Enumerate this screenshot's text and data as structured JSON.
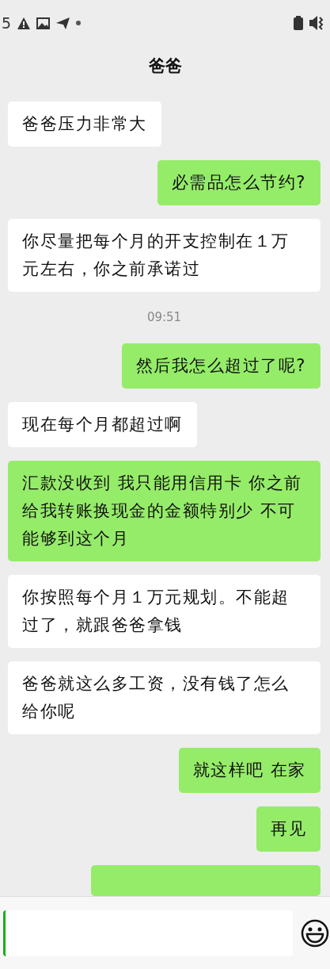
{
  "status_bar": {
    "time": "5"
  },
  "header": {
    "title": "爸爸"
  },
  "messages": [
    {
      "kind": "message",
      "sent": false,
      "text": "爸爸压力非常大"
    },
    {
      "kind": "message",
      "sent": true,
      "text": "必需品怎么节约?"
    },
    {
      "kind": "message",
      "sent": false,
      "text": "你尽量把每个月的开支控制在１万元左右，你之前承诺过"
    },
    {
      "kind": "time",
      "text": "09:51"
    },
    {
      "kind": "message",
      "sent": true,
      "text": "然后我怎么超过了呢?"
    },
    {
      "kind": "message",
      "sent": false,
      "text": "现在每个月都超过啊"
    },
    {
      "kind": "message",
      "sent": true,
      "text": "汇款没收到 我只能用信用卡 你之前给我转账换现金的金额特别少 不可能够到这个月"
    },
    {
      "kind": "message",
      "sent": false,
      "text": "你按照每个月１万元规划。不能超过了，就跟爸爸拿钱"
    },
    {
      "kind": "message",
      "sent": false,
      "text": "爸爸就这么多工资，没有钱了怎么给你呢"
    },
    {
      "kind": "message",
      "sent": true,
      "text": "就这样吧 在家"
    },
    {
      "kind": "message",
      "sent": true,
      "text": "再见"
    },
    {
      "kind": "cut",
      "sent": true
    }
  ]
}
